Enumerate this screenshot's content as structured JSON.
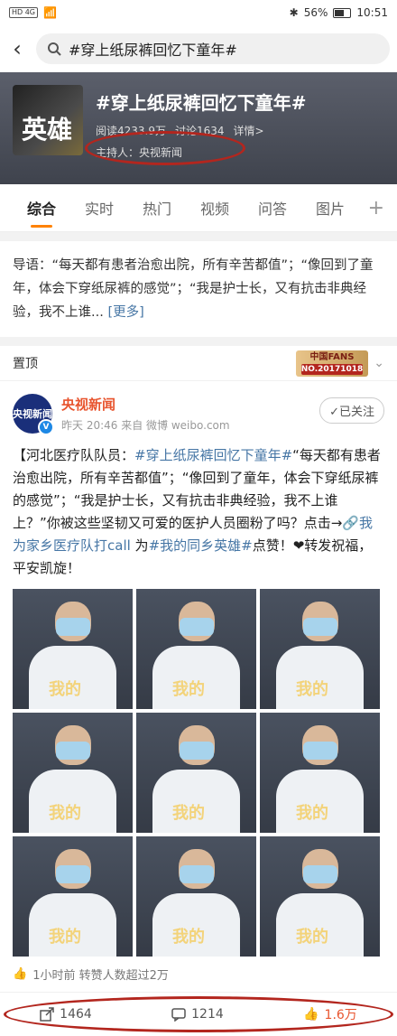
{
  "status_bar": {
    "carrier_icons": "HD 4G",
    "battery": "56%",
    "time": "10:51"
  },
  "search": {
    "query": "#穿上纸尿裤回忆下童年#"
  },
  "topic": {
    "title": "#穿上纸尿裤回忆下童年#",
    "reads": "阅读4233.9万",
    "discussions": "讨论1634",
    "details": "详情>",
    "host": "主持人：央视新闻"
  },
  "tabs": [
    "综合",
    "实时",
    "热门",
    "视频",
    "问答",
    "图片"
  ],
  "intro": {
    "text": "导语：“每天都有患者治愈出院，所有辛苦都值”；“像回到了童年，体会下穿纸尿裤的感觉”；“我是护士长，又有抗击非典经验，我不上谁...",
    "more": "[更多]"
  },
  "pinned": {
    "label": "置顶",
    "badge_top": "中国FANS",
    "badge_no": "NO.20171018"
  },
  "post": {
    "avatar_text": "央视新闻",
    "author": "央视新闻",
    "time": "昨天 20:46",
    "source": "来自 微博 weibo.com",
    "follow": "✓已关注",
    "text_a": "【河北医疗队队员：",
    "tag1": "#穿上纸尿裤回忆下童年#",
    "text_b": "“每天都有患者治愈出院，所有辛苦都值”；“像回到了童年，体会下穿纸尿裤的感觉”；“我是护士长，又有抗击非典经验，我不上谁上？”你被这些坚韧又可爱的医护人员圈粉了吗？点击→",
    "link": "🔗我为家乡医疗队打call",
    "text_c": " 为",
    "tag2": "#我的同乡英雄#",
    "text_d": "点赞！❤转发祝福，平安凯旋！",
    "image_stamp": "我的"
  },
  "footnote": "1小时前 转赞人数超过2万",
  "actions": {
    "reposts": "1464",
    "comments": "1214",
    "likes": "1.6万"
  },
  "colors": {
    "accent": "#ff8200",
    "link": "#4676a5",
    "author": "#e8542e",
    "highlight": "#b3261e"
  }
}
